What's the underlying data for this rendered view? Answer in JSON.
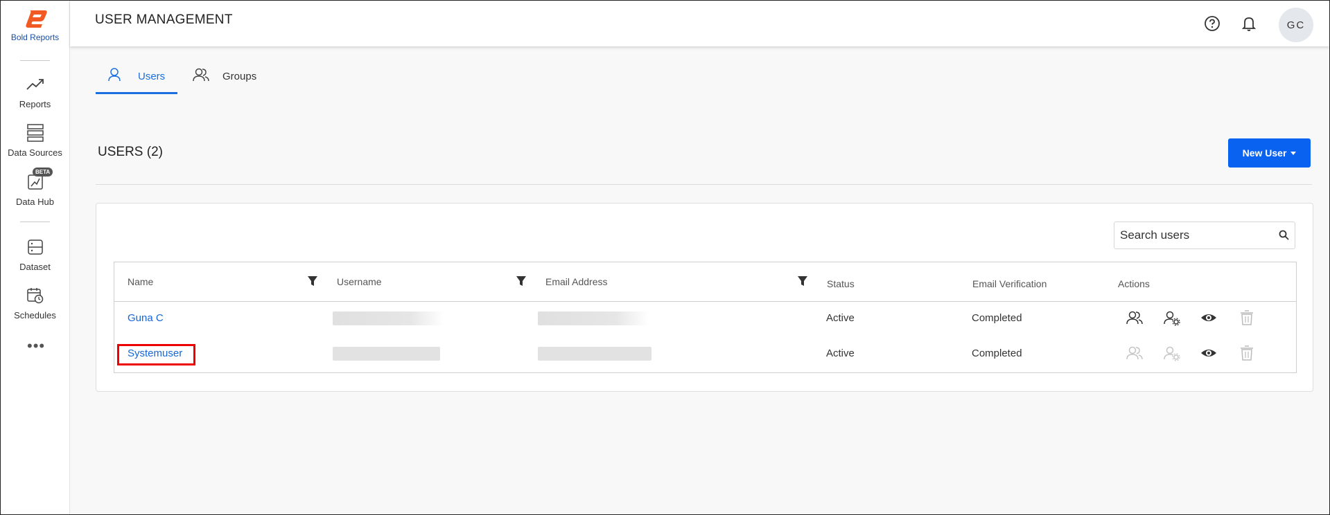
{
  "brand": {
    "name": "Bold Reports",
    "color": "#f15a22"
  },
  "sidebar": {
    "items": [
      {
        "label": "Reports",
        "icon": "trend-icon"
      },
      {
        "label": "Data Sources",
        "icon": "database-icon"
      },
      {
        "label": "Data Hub",
        "icon": "data-hub-icon",
        "badge": "BETA"
      },
      {
        "label": "Dataset",
        "icon": "dataset-icon"
      },
      {
        "label": "Schedules",
        "icon": "calendar-clock-icon"
      }
    ],
    "more": "•••"
  },
  "header": {
    "title": "USER MANAGEMENT",
    "avatar_initials": "GC"
  },
  "tabs": [
    {
      "label": "Users",
      "active": true
    },
    {
      "label": "Groups",
      "active": false
    }
  ],
  "section": {
    "title": "USERS (2)",
    "new_user_label": "New User"
  },
  "search": {
    "placeholder": "Search users",
    "value": ""
  },
  "table": {
    "columns": [
      "Name",
      "Username",
      "Email Address",
      "Status",
      "Email Verification",
      "Actions"
    ],
    "rows": [
      {
        "name": "Guna C",
        "username": "",
        "email": "",
        "status": "Active",
        "verification": "Completed"
      },
      {
        "name": "Systemuser",
        "username": "",
        "email": "",
        "status": "Active",
        "verification": "Completed"
      }
    ]
  },
  "colors": {
    "accent": "#0a63f0",
    "link": "#1565d8",
    "highlight": "#e00000"
  }
}
